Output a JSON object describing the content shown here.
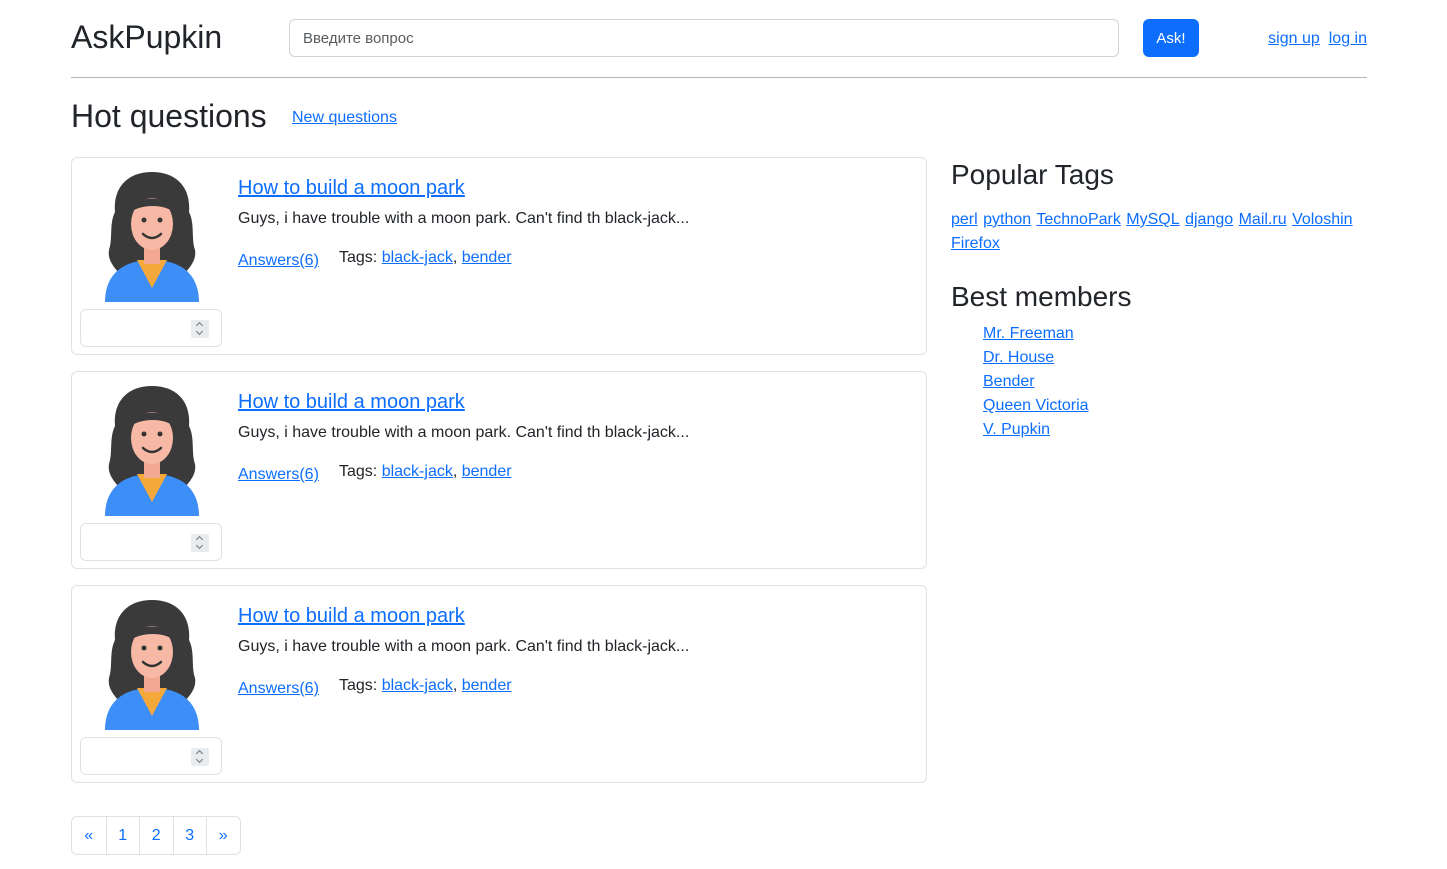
{
  "header": {
    "logo": "AskPupkin",
    "search_placeholder": "Введите вопрос",
    "ask_label": "Ask!",
    "signup_label": "sign up",
    "login_label": "log in"
  },
  "main": {
    "title": "Hot questions",
    "new_questions_label": "New questions"
  },
  "questions": [
    {
      "title": "How to build a moon park",
      "text": "Guys, i have trouble with a moon park. Can't find th black-jack...",
      "answers_label": "Answers(6)",
      "tags_label": "Tags:",
      "tags": [
        "black-jack",
        "bender"
      ]
    },
    {
      "title": "How to build a moon park",
      "text": "Guys, i have trouble with a moon park. Can't find th black-jack...",
      "answers_label": "Answers(6)",
      "tags_label": "Tags:",
      "tags": [
        "black-jack",
        "bender"
      ]
    },
    {
      "title": "How to build a moon park",
      "text": "Guys, i have trouble with a moon park. Can't find th black-jack...",
      "answers_label": "Answers(6)",
      "tags_label": "Tags:",
      "tags": [
        "black-jack",
        "bender"
      ]
    }
  ],
  "sidebar": {
    "popular_tags_title": "Popular Tags",
    "tags": [
      "perl",
      "python",
      "TechnoPark",
      "MySQL",
      "django",
      "Mail.ru",
      "Voloshin",
      "Firefox"
    ],
    "best_members_title": "Best members",
    "members": [
      "Mr. Freeman",
      "Dr. House",
      "Bender",
      "Queen Victoria",
      "V. Pupkin"
    ]
  },
  "pagination": {
    "prev": "«",
    "pages": [
      "1",
      "2",
      "3"
    ],
    "next": "»"
  },
  "colors": {
    "accent": "#0d6efd",
    "border": "#dee2e6",
    "text": "#212529"
  }
}
